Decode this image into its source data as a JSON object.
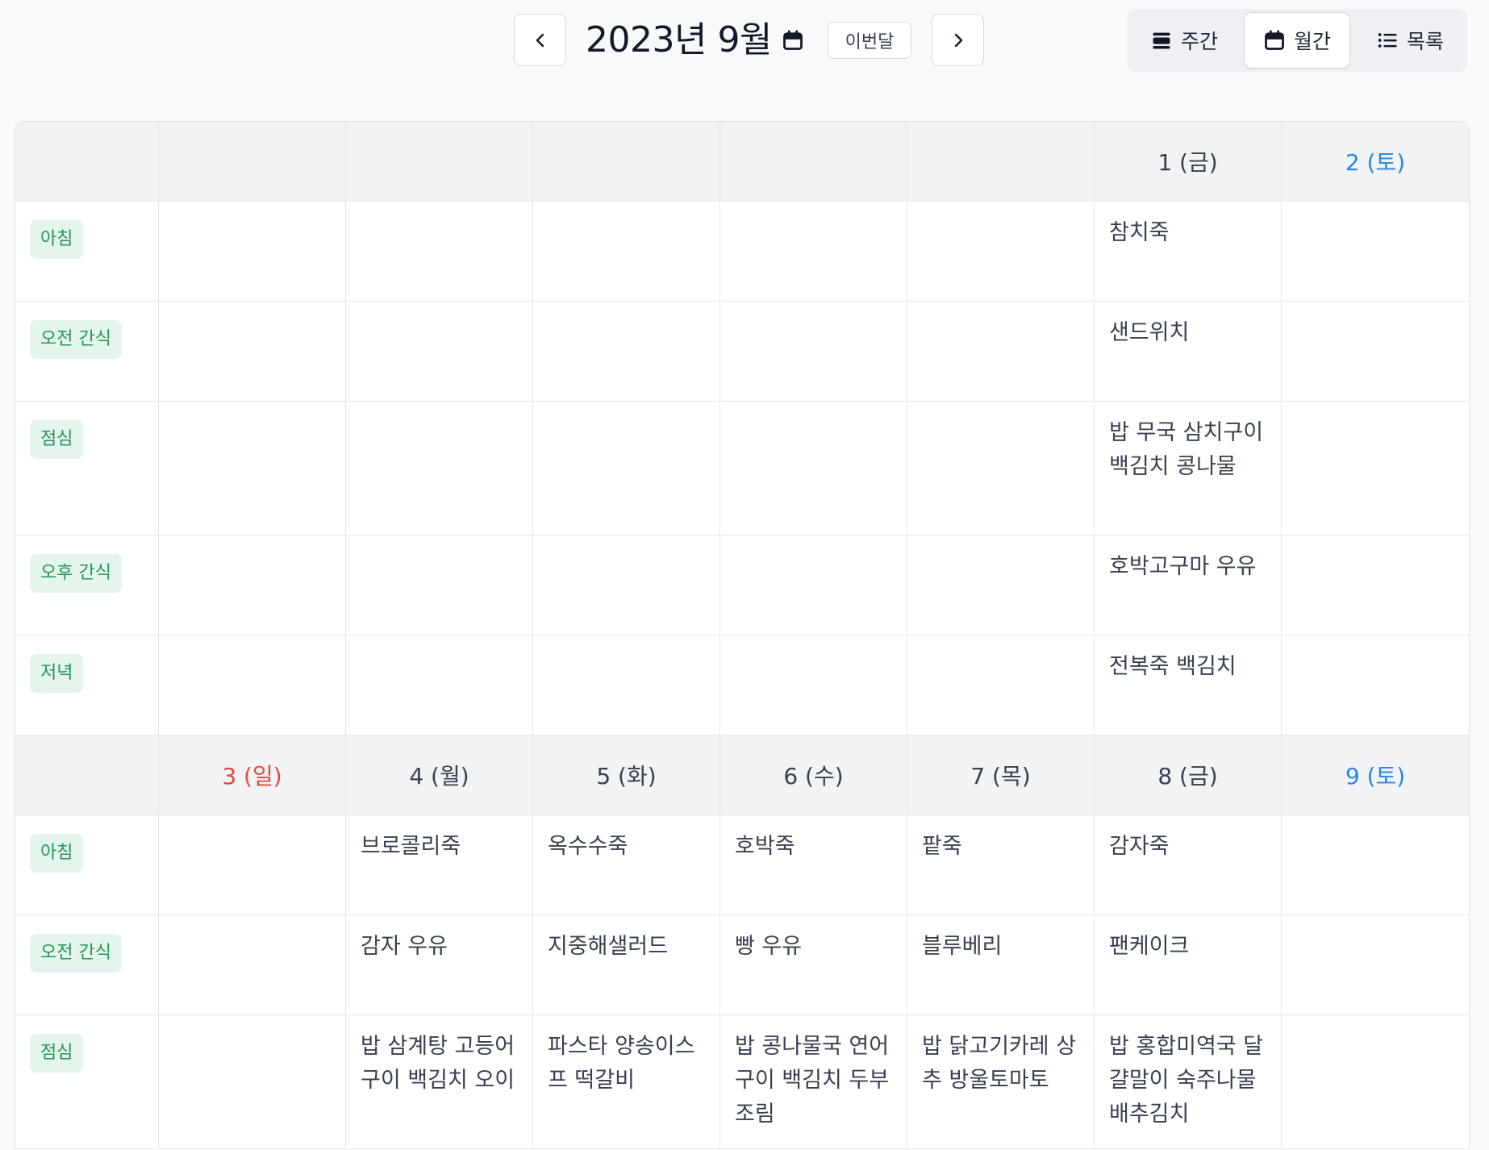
{
  "header": {
    "title": "2023년 9월",
    "today_label": "이번달",
    "views": {
      "week": "주간",
      "month": "월간",
      "list": "목록"
    },
    "active_view": "month"
  },
  "meal_labels": {
    "breakfast": "아침",
    "am_snack": "오전 간식",
    "lunch": "점심",
    "pm_snack": "오후 간식",
    "dinner": "저녁"
  },
  "weeks": [
    {
      "days": [
        "",
        "",
        "",
        "",
        "",
        "1 (금)",
        "2 (토)"
      ],
      "meals": {
        "breakfast": [
          "",
          "",
          "",
          "",
          "",
          "참치죽",
          ""
        ],
        "am_snack": [
          "",
          "",
          "",
          "",
          "",
          "샌드위치",
          ""
        ],
        "lunch": [
          "",
          "",
          "",
          "",
          "",
          "밥 무국 삼치구이 백김치 콩나물",
          ""
        ],
        "pm_snack": [
          "",
          "",
          "",
          "",
          "",
          "호박고구마 우유",
          ""
        ],
        "dinner": [
          "",
          "",
          "",
          "",
          "",
          "전복죽 백김치",
          ""
        ]
      }
    },
    {
      "days": [
        "3 (일)",
        "4 (월)",
        "5 (화)",
        "6 (수)",
        "7 (목)",
        "8 (금)",
        "9 (토)"
      ],
      "meals": {
        "breakfast": [
          "",
          "브로콜리죽",
          "옥수수죽",
          "호박죽",
          "팥죽",
          "감자죽",
          ""
        ],
        "am_snack": [
          "",
          "감자 우유",
          "지중해샐러드",
          "빵 우유",
          "블루베리",
          "팬케이크",
          ""
        ],
        "lunch": [
          "",
          "밥 삼계탕 고등어구이 백김치 오이",
          "파스타 양송이스프 떡갈비",
          "밥 콩나물국 연어구이 백김치 두부조림",
          "밥 닭고기카레 상추 방울토마토",
          "밥 홍합미역국 달걀말이 숙주나물 배추김치",
          ""
        ]
      }
    }
  ],
  "colors": {
    "sunday": "#e5483b",
    "saturday": "#2a86e8",
    "badge_bg": "#e4f5ec",
    "badge_text": "#27955b"
  }
}
